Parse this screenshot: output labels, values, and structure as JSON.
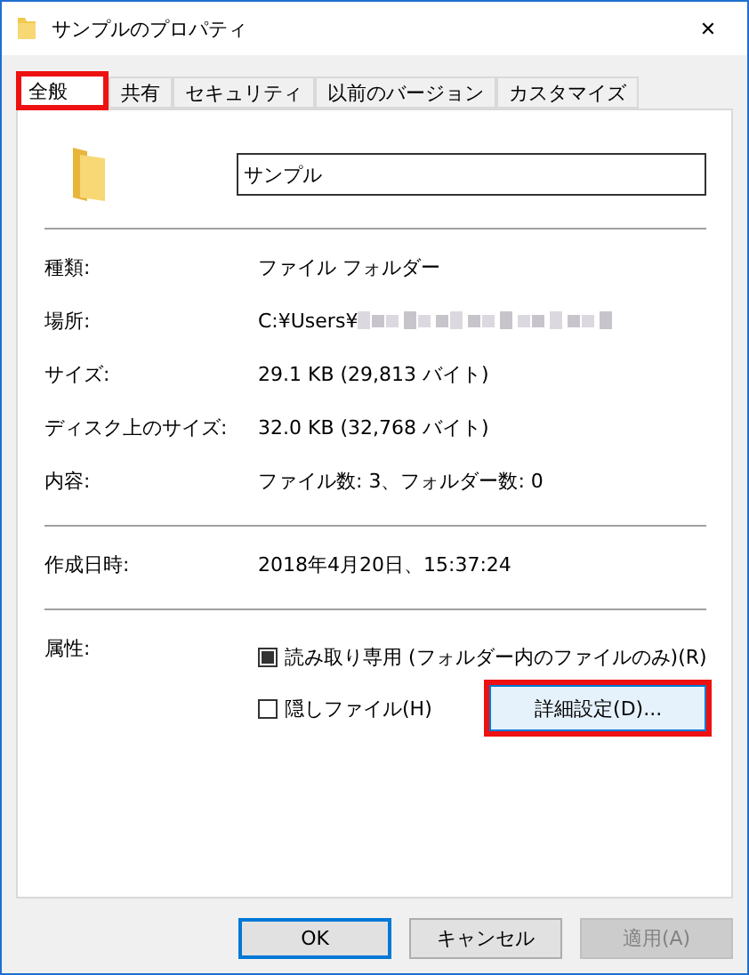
{
  "window": {
    "title": "サンプルのプロパティ",
    "close": "✕"
  },
  "tabs": [
    {
      "label": "全般",
      "selected": true,
      "highlighted": true
    },
    {
      "label": "共有",
      "selected": false,
      "highlighted": false
    },
    {
      "label": "セキュリティ",
      "selected": false,
      "highlighted": false
    },
    {
      "label": "以前のバージョン",
      "selected": false,
      "highlighted": false
    },
    {
      "label": "カスタマイズ",
      "selected": false,
      "highlighted": false
    }
  ],
  "name_field": {
    "value": "サンプル"
  },
  "properties": [
    {
      "label": "種類:",
      "value": "ファイル フォルダー"
    },
    {
      "label": "場所:",
      "value": "C:¥Users¥",
      "blurred": true
    },
    {
      "label": "サイズ:",
      "value": "29.1 KB (29,813 バイト)"
    },
    {
      "label": "ディスク上のサイズ:",
      "value": "32.0 KB (32,768 バイト)"
    },
    {
      "label": "内容:",
      "value": "ファイル数: 3、フォルダー数: 0"
    }
  ],
  "dates": [
    {
      "label": "作成日時:",
      "value": "2018年4月20日、15:37:24"
    }
  ],
  "attributes": {
    "label": "属性:",
    "checkboxes": [
      {
        "label": "読み取り専用 (フォルダー内のファイルのみ)(R)",
        "checked": false,
        "indeterminate": true
      },
      {
        "label": "隠しファイル(H)",
        "checked": false,
        "indeterminate": false
      }
    ],
    "advanced_button": {
      "label": "詳細設定(D)...",
      "highlighted": true
    }
  },
  "buttons": [
    {
      "label": "OK",
      "kind": "default",
      "disabled": false
    },
    {
      "label": "キャンセル",
      "kind": "normal",
      "disabled": false
    },
    {
      "label": "適用(A)",
      "kind": "normal",
      "disabled": true
    }
  ]
}
